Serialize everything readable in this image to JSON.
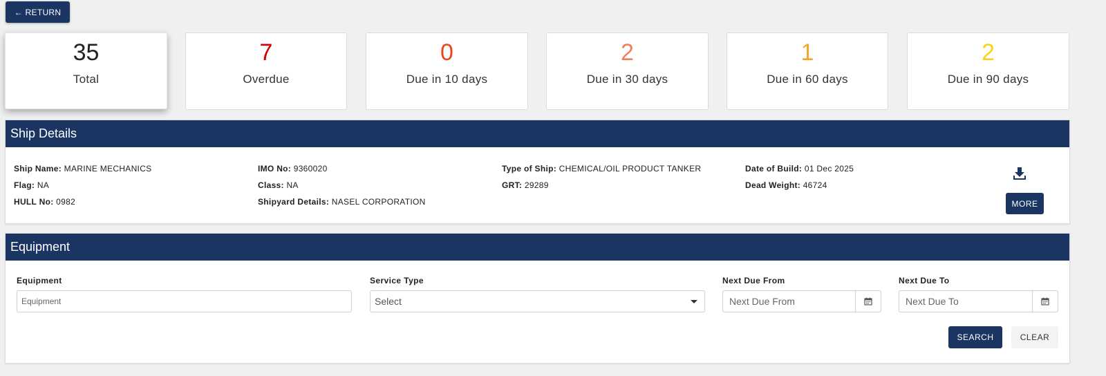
{
  "return_button": {
    "label": "← RETURN"
  },
  "stats": [
    {
      "count": "35",
      "label": "Total",
      "color": "#222222"
    },
    {
      "count": "7",
      "label": "Overdue",
      "color": "#d50000"
    },
    {
      "count": "0",
      "label": "Due in 10 days",
      "color": "#e8471c"
    },
    {
      "count": "2",
      "label": "Due in 30 days",
      "color": "#f0805a"
    },
    {
      "count": "1",
      "label": "Due in 60 days",
      "color": "#f5a623"
    },
    {
      "count": "2",
      "label": "Due in 90 days",
      "color": "#f7d31c"
    }
  ],
  "ship_details": {
    "title": "Ship Details",
    "columns": [
      [
        {
          "key": "Ship Name:",
          "value": "MARINE MECHANICS"
        },
        {
          "key": "Flag:",
          "value": "NA"
        },
        {
          "key": "HULL No:",
          "value": "0982"
        }
      ],
      [
        {
          "key": "IMO No:",
          "value": "9360020"
        },
        {
          "key": "Class:",
          "value": "NA"
        },
        {
          "key": "Shipyard Details:",
          "value": "NASEL CORPORATION"
        }
      ],
      [
        {
          "key": "Type of Ship:",
          "value": "CHEMICAL/OIL PRODUCT TANKER"
        },
        {
          "key": "GRT:",
          "value": "29289"
        }
      ],
      [
        {
          "key": "Date of Build:",
          "value": "01 Dec 2025"
        },
        {
          "key": "Dead Weight:",
          "value": "46724"
        }
      ]
    ],
    "download_icon": "download-icon",
    "more_label": "MORE"
  },
  "equipment": {
    "title": "Equipment",
    "fields": {
      "equipment_label": "Equipment",
      "equipment_placeholder": "Equipment",
      "service_type_label": "Service Type",
      "service_type_value": "Select",
      "next_due_from_label": "Next Due From",
      "next_due_from_placeholder": "Next Due From",
      "next_due_to_label": "Next Due To",
      "next_due_to_placeholder": "Next Due To"
    },
    "search_label": "SEARCH",
    "clear_label": "CLEAR"
  },
  "theme": {
    "primary": "#1b3563"
  }
}
